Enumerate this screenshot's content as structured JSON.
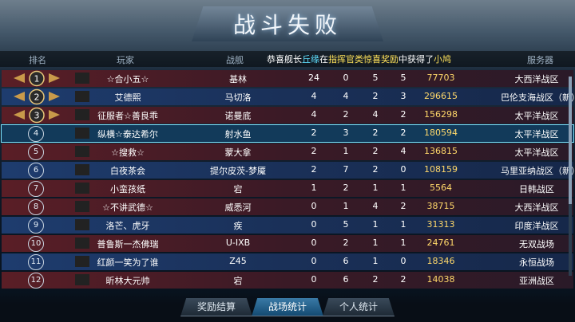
{
  "title": "战斗失败",
  "columns": [
    "排名",
    "玩家",
    "战舰",
    "服务器"
  ],
  "banner": {
    "pre": "恭喜舰长",
    "player": "丘缘",
    "mid": "在",
    "event": "指挥官类惊喜奖励",
    "post": "中获得了",
    "item": "小鸠"
  },
  "rows": [
    {
      "rank": "1",
      "name": "☆合小五☆",
      "ship": "基林",
      "n1": "24",
      "n2": "0",
      "n3": "5",
      "n4": "5",
      "score": "77703",
      "server": "大西洋战区",
      "style": "red"
    },
    {
      "rank": "2",
      "name": "艾德熙",
      "ship": "马切洛",
      "n1": "4",
      "n2": "4",
      "n3": "2",
      "n4": "3",
      "score": "296615",
      "server": "巴伦支海战区（新）",
      "style": "blue"
    },
    {
      "rank": "3",
      "name": "征服者☆善良乖",
      "ship": "诺曼底",
      "n1": "4",
      "n2": "2",
      "n3": "4",
      "n4": "2",
      "score": "156298",
      "server": "太平洋战区",
      "style": "red"
    },
    {
      "rank": "4",
      "name": "纵横☆泰达希尔",
      "ship": "射水鱼",
      "n1": "2",
      "n2": "3",
      "n3": "2",
      "n4": "2",
      "score": "180594",
      "server": "太平洋战区",
      "style": "sel"
    },
    {
      "rank": "5",
      "name": "☆搜救☆",
      "ship": "蒙大拿",
      "n1": "2",
      "n2": "1",
      "n3": "2",
      "n4": "4",
      "score": "136815",
      "server": "太平洋战区",
      "style": "red"
    },
    {
      "rank": "6",
      "name": "白夜茶会",
      "ship": "提尔皮茨-梦魇",
      "n1": "2",
      "n2": "7",
      "n3": "2",
      "n4": "0",
      "score": "108159",
      "server": "马里亚纳战区（新）",
      "style": "blue"
    },
    {
      "rank": "7",
      "name": "小蛮孩纸",
      "ship": "宕",
      "n1": "1",
      "n2": "2",
      "n3": "1",
      "n4": "1",
      "score": "5564",
      "server": "日韩战区",
      "style": "red"
    },
    {
      "rank": "8",
      "name": "☆不讲武德☆",
      "ship": "威悉河",
      "n1": "0",
      "n2": "1",
      "n3": "4",
      "n4": "2",
      "score": "38715",
      "server": "大西洋战区",
      "style": "red"
    },
    {
      "rank": "9",
      "name": "洛芒、虎牙",
      "ship": "疾",
      "n1": "0",
      "n2": "5",
      "n3": "1",
      "n4": "1",
      "score": "31313",
      "server": "印度洋战区",
      "style": "blue"
    },
    {
      "rank": "10",
      "name": "普鲁斯一杰佛瑞",
      "ship": "U-IXB",
      "n1": "0",
      "n2": "2",
      "n3": "1",
      "n4": "1",
      "score": "24761",
      "server": "无双战场",
      "style": "red"
    },
    {
      "rank": "11",
      "name": "红颜一笑为了谁",
      "ship": "Z45",
      "n1": "0",
      "n2": "6",
      "n3": "1",
      "n4": "0",
      "score": "18346",
      "server": "永恒战场",
      "style": "blue"
    },
    {
      "rank": "12",
      "name": "昕林大元帅",
      "ship": "宕",
      "n1": "0",
      "n2": "6",
      "n3": "2",
      "n4": "2",
      "score": "14038",
      "server": "亚洲战区",
      "style": "red"
    }
  ],
  "tabs": [
    "奖励结算",
    "战场统计",
    "个人统计"
  ],
  "active_tab": 1,
  "colors": {
    "accent": "#7fe6ff",
    "score": "#ffd86a",
    "red_row": "#5a1e26",
    "blue_row": "#1e3c6e"
  }
}
